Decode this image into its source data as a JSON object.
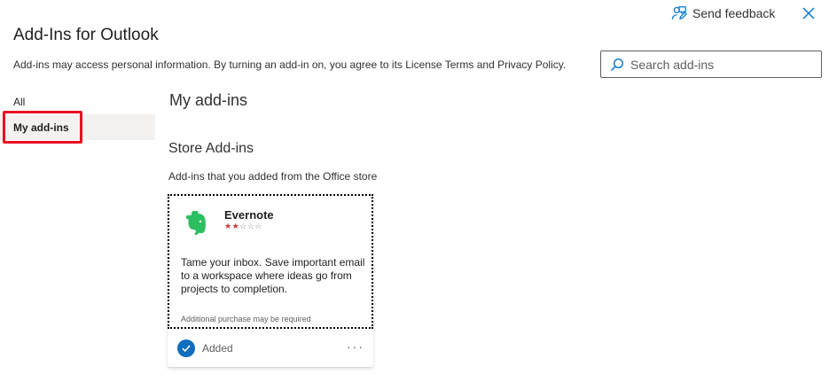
{
  "header": {
    "feedback_label": "Send feedback",
    "title": "Add-Ins for Outlook",
    "subtitle": "Add-ins may access personal information. By turning an add-in on, you agree to its License Terms and Privacy Policy."
  },
  "search": {
    "placeholder": "Search add-ins",
    "value": ""
  },
  "nav": {
    "items": [
      {
        "label": "All",
        "selected": false
      },
      {
        "label": "My add-ins",
        "selected": true
      }
    ]
  },
  "main": {
    "title": "My add-ins",
    "section_title": "Store Add-ins",
    "section_desc": "Add-ins that you added from the Office store"
  },
  "card": {
    "name": "Evernote",
    "rating": 2,
    "rating_max": 5,
    "description": "Tame your inbox. Save important email to a workspace where ideas go from projects to completion.",
    "note": "Additional purchase may be required",
    "status": "Added",
    "more": "···"
  },
  "icons": {
    "feedback": "feedback-person-icon",
    "close": "close-icon",
    "search": "search-icon",
    "logo": "evernote-elephant-icon",
    "check": "checkmark-icon"
  },
  "colors": {
    "accent": "#106ebe",
    "highlight": "#e81123",
    "evernote_green": "#2dbe60",
    "star_on": "#d13438"
  }
}
